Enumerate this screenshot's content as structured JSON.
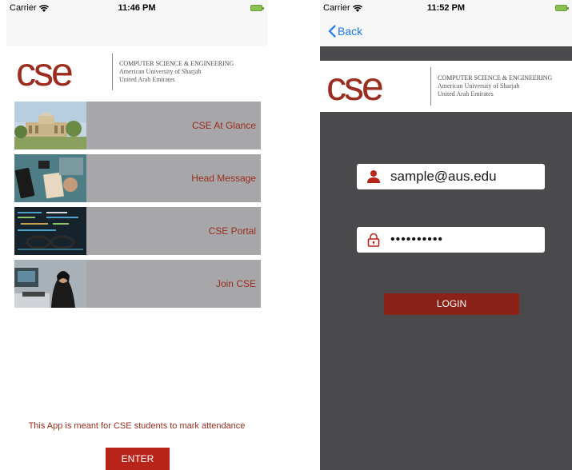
{
  "left_screen": {
    "status": {
      "carrier": "Carrier",
      "time": "11:46 PM"
    },
    "logo": {
      "mark": "CSE",
      "line1": "COMPUTER SCIENCE & ENGINEERING",
      "line2": "American University of Sharjah",
      "line3": "United Arab Emirates"
    },
    "menu": [
      {
        "label": "CSE At Glance",
        "icon": "campus-photo"
      },
      {
        "label": "Head Message",
        "icon": "desk-photo"
      },
      {
        "label": "CSE Portal",
        "icon": "code-screen-photo"
      },
      {
        "label": "Join CSE",
        "icon": "student-photo"
      }
    ],
    "footer_message": "This App is meant for CSE students to mark attendance",
    "enter_label": "ENTER"
  },
  "right_screen": {
    "status": {
      "carrier": "Carrier",
      "time": "11:52 PM"
    },
    "back_label": "Back",
    "logo": {
      "mark": "CSE",
      "line1": "COMPUTER SCIENCE & ENGINEERING",
      "line2": "American University of Sharjah",
      "line3": "United Arab Emirates"
    },
    "email_value": "sample@aus.edu",
    "password_mask": "••••••••••",
    "login_label": "LOGIN"
  },
  "colors": {
    "brand": "#9b2c1e",
    "enter_button": "#b8231a",
    "login_button": "#8a2218",
    "ios_blue": "#1a7bf5"
  }
}
